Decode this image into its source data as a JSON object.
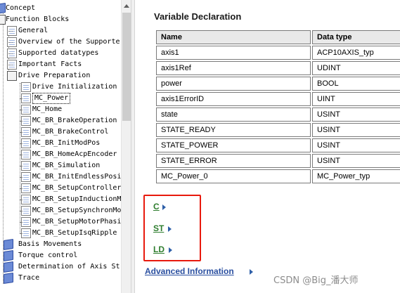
{
  "tree": {
    "items": [
      {
        "label": "Concept",
        "icon": "book-closed-icon"
      },
      {
        "label": "Function Blocks",
        "icon": "book-open-icon"
      },
      {
        "label": "General",
        "icon": "page-icon"
      },
      {
        "label": "Overview of the Supporte",
        "icon": "page-icon"
      },
      {
        "label": "Supported datatypes",
        "icon": "page-icon"
      },
      {
        "label": "Important Facts",
        "icon": "page-icon"
      },
      {
        "label": "Drive Preparation",
        "icon": "book-open-icon"
      },
      {
        "label": "Drive Initialization",
        "icon": "page-icon"
      },
      {
        "label": "MC_Power",
        "icon": "page-icon",
        "selected": true
      },
      {
        "label": "MC_Home",
        "icon": "page-icon"
      },
      {
        "label": "MC_BR_BrakeOperation",
        "icon": "page-icon"
      },
      {
        "label": "MC_BR_BrakeControl",
        "icon": "page-icon"
      },
      {
        "label": "MC_BR_InitModPos",
        "icon": "page-icon"
      },
      {
        "label": "MC_BR_HomeAcpEncoder",
        "icon": "page-icon"
      },
      {
        "label": "MC_BR_Simulation",
        "icon": "page-icon"
      },
      {
        "label": "MC_BR_InitEndlessPosi",
        "icon": "page-icon"
      },
      {
        "label": "MC_BR_SetupController",
        "icon": "page-icon"
      },
      {
        "label": "MC_BR_SetupInductionM",
        "icon": "page-icon"
      },
      {
        "label": "MC_BR_SetupSynchronMo",
        "icon": "page-icon"
      },
      {
        "label": "MC_BR_SetupMotorPhasi",
        "icon": "page-icon"
      },
      {
        "label": "MC_BR_SetupIsqRipple",
        "icon": "page-icon"
      },
      {
        "label": "Basis Movements",
        "icon": "book-closed-icon"
      },
      {
        "label": "Torque control",
        "icon": "book-closed-icon"
      },
      {
        "label": "Determination of Axis St",
        "icon": "book-closed-icon"
      },
      {
        "label": "Trace",
        "icon": "book-closed-icon"
      }
    ]
  },
  "content": {
    "section_title": "Variable Declaration",
    "table": {
      "headers": [
        "Name",
        "Data type"
      ],
      "rows": [
        [
          "axis1",
          "ACP10AXIS_typ"
        ],
        [
          "axis1Ref",
          "UDINT"
        ],
        [
          "power",
          "BOOL"
        ],
        [
          "axis1ErrorID",
          "UINT"
        ],
        [
          "state",
          "USINT"
        ],
        [
          "STATE_READY",
          "USINT"
        ],
        [
          "STATE_POWER",
          "USINT"
        ],
        [
          "STATE_ERROR",
          "USINT"
        ],
        [
          "MC_Power_0",
          "MC_Power_typ"
        ]
      ]
    },
    "lang_links": [
      "C",
      "ST",
      "LD"
    ],
    "advanced_link": "Advanced Information",
    "watermark": "CSDN @Big_潘大师"
  },
  "colors": {
    "highlight_box": "#e8190d",
    "lang_link": "#2e7d2e",
    "advanced_link": "#2a4fa0",
    "table_header_bg": "#e9e9e9"
  }
}
